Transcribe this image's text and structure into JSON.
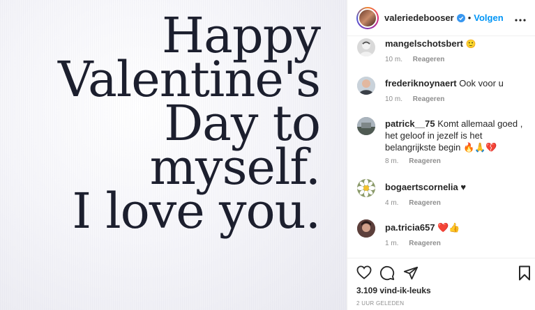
{
  "post": {
    "lines": [
      "Happy",
      "Valentine's",
      "Day to",
      "myself.",
      "I love you."
    ]
  },
  "header": {
    "username": "valeriedebooser",
    "separator": "•",
    "follow_label": "Volgen"
  },
  "comments": [
    {
      "user": "mangelschotsbert",
      "text": "🙂",
      "time": "10 m.",
      "reply_label": "Reageren"
    },
    {
      "user": "frederiknoynaert",
      "text": "Ook voor u",
      "time": "10 m.",
      "reply_label": "Reageren"
    },
    {
      "user": "patrick__75",
      "text": "Komt allemaal goed , het geloof in jezelf is het belangrijkste begin 🔥🙏💔",
      "time": "8 m.",
      "reply_label": "Reageren"
    },
    {
      "user": "bogaertscornelia",
      "text": "♥",
      "time": "4 m.",
      "reply_label": "Reageren"
    },
    {
      "user": "pa.tricia657",
      "text": "❤️👍",
      "time": "1 m.",
      "reply_label": "Reageren"
    }
  ],
  "footer": {
    "likes": "3.109 vind-ik-leuks",
    "posted": "2 UUR GELEDEN"
  },
  "colors": {
    "accent": "#0095f6",
    "verified": "#3897f0",
    "text": "#262626",
    "muted": "#8e8e8e",
    "post_text": "#1c1f2e"
  }
}
